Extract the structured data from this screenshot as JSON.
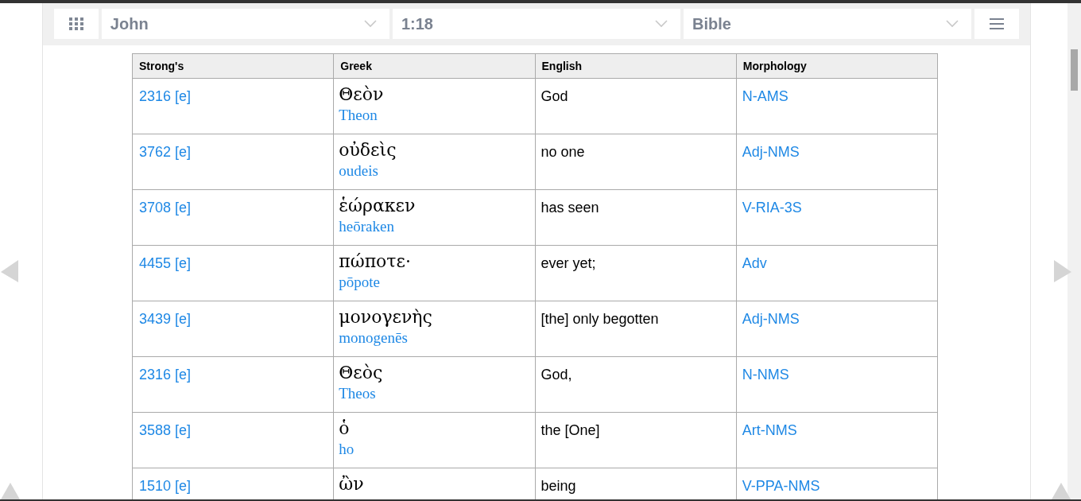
{
  "toolbar": {
    "selects": [
      {
        "value": "John"
      },
      {
        "value": "1:18"
      },
      {
        "value": "Bible"
      }
    ]
  },
  "table": {
    "columns": [
      "Strong's",
      "Greek",
      "English",
      "Morphology"
    ],
    "rows": [
      {
        "strongs": "2316 [e]",
        "greek": "Θεὸν",
        "translit": "Theon",
        "english": "God",
        "morphology": "N-AMS"
      },
      {
        "strongs": "3762 [e]",
        "greek": "οὐδεὶς",
        "translit": "oudeis",
        "english": "no one",
        "morphology": "Adj-NMS"
      },
      {
        "strongs": "3708 [e]",
        "greek": "ἑώρακεν",
        "translit": "heōraken",
        "english": "has seen",
        "morphology": "V-RIA-3S"
      },
      {
        "strongs": "4455 [e]",
        "greek": "πώποτε·",
        "translit": "pōpote",
        "english": "ever yet;",
        "morphology": "Adv"
      },
      {
        "strongs": "3439 [e]",
        "greek": "μονογενὴς",
        "translit": "monogenēs",
        "english": "[the] only begotten",
        "morphology": "Adj-NMS"
      },
      {
        "strongs": "2316 [e]",
        "greek": "Θεὸς",
        "translit": "Theos",
        "english": "God,",
        "morphology": "N-NMS"
      },
      {
        "strongs": "3588 [e]",
        "greek": "ὁ",
        "translit": "ho",
        "english": "the [One]",
        "morphology": "Art-NMS"
      },
      {
        "strongs": "1510 [e]",
        "greek": "ὢν",
        "english": "being",
        "morphology": "V-PPA-NMS"
      }
    ]
  }
}
